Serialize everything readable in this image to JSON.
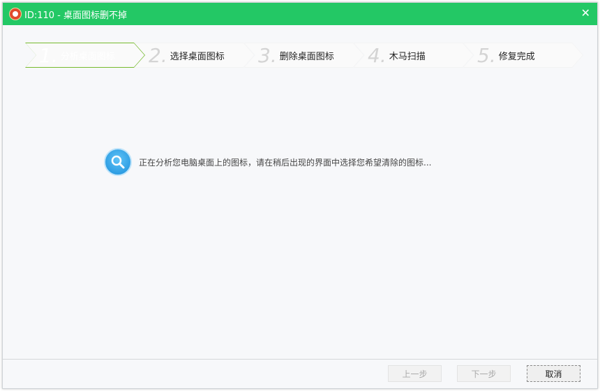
{
  "window": {
    "title": "ID:110 - 桌面图标删不掉",
    "close": "✕"
  },
  "steps": [
    {
      "num": "1.",
      "label": "分析桌面图标",
      "active": true
    },
    {
      "num": "2.",
      "label": "选择桌面图标",
      "active": false
    },
    {
      "num": "3.",
      "label": "删除桌面图标",
      "active": false
    },
    {
      "num": "4.",
      "label": "木马扫描",
      "active": false
    },
    {
      "num": "5.",
      "label": "修复完成",
      "active": false
    }
  ],
  "status": {
    "message": "正在分析您电脑桌面上的图标，请在稍后出现的界面中选择您希望清除的图标..."
  },
  "buttons": {
    "prev": "上一步",
    "next": "下一步",
    "cancel": "取消"
  },
  "colors": {
    "titlebar": "#23c865",
    "active_step": "#77bb2d"
  }
}
